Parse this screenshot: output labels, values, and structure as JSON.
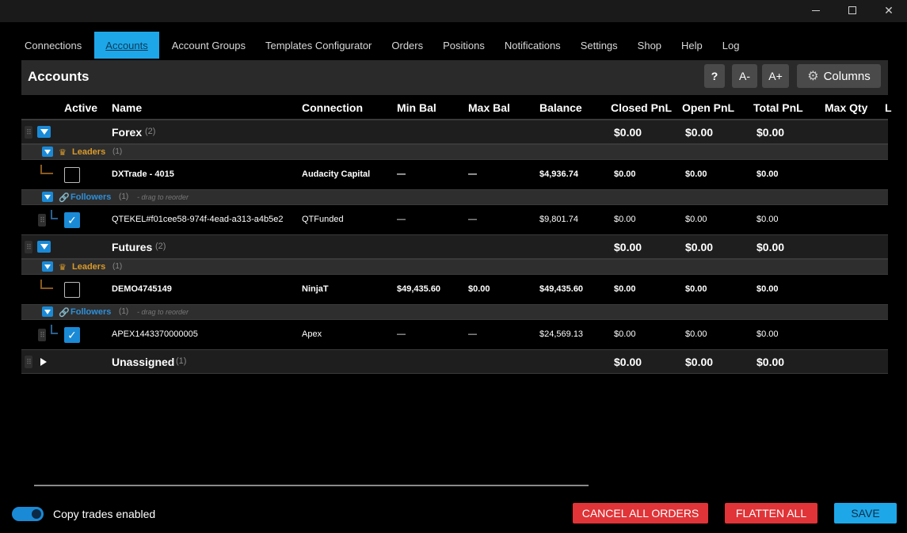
{
  "tabs": [
    "Connections",
    "Accounts",
    "Account Groups",
    "Templates Configurator",
    "Orders",
    "Positions",
    "Notifications",
    "Settings",
    "Shop",
    "Help",
    "Log"
  ],
  "active_tab": "Accounts",
  "panel": {
    "title": "Accounts",
    "help_label": "?",
    "font_down_label": "A-",
    "font_up_label": "A+",
    "columns_label": "Columns"
  },
  "columns": [
    "Active",
    "Name",
    "Connection",
    "Min Bal",
    "Max Bal",
    "Balance",
    "Closed PnL",
    "Open PnL",
    "Total PnL",
    "Max Qty",
    "L"
  ],
  "groups": [
    {
      "name": "Forex",
      "count": "(2)",
      "closed_pnl": "$0.00",
      "open_pnl": "$0.00",
      "total_pnl": "$0.00",
      "leaders": {
        "label": "Leaders",
        "count": "(1)",
        "accounts": [
          {
            "name": "DXTrade - 4015",
            "connection": "Audacity Capital",
            "min_bal": "—",
            "max_bal": "—",
            "balance": "$4,936.74",
            "closed_pnl": "$0.00",
            "open_pnl": "$0.00",
            "total_pnl": "$0.00",
            "active": false
          }
        ]
      },
      "followers": {
        "label": "Followers",
        "count": "(1)",
        "hint": "- drag to reorder",
        "accounts": [
          {
            "name": "QTEKEL#f01cee58-974f-4ead-a313-a4b5e2",
            "connection": "QTFunded",
            "min_bal": "—",
            "max_bal": "—",
            "balance": "$9,801.74",
            "closed_pnl": "$0.00",
            "open_pnl": "$0.00",
            "total_pnl": "$0.00",
            "active": true
          }
        ]
      }
    },
    {
      "name": "Futures",
      "count": "(2)",
      "closed_pnl": "$0.00",
      "open_pnl": "$0.00",
      "total_pnl": "$0.00",
      "leaders": {
        "label": "Leaders",
        "count": "(1)",
        "accounts": [
          {
            "name": "DEMO4745149",
            "connection": "NinjaT",
            "min_bal": "$49,435.60",
            "max_bal": "$0.00",
            "balance": "$49,435.60",
            "closed_pnl": "$0.00",
            "open_pnl": "$0.00",
            "total_pnl": "$0.00",
            "active": false
          }
        ]
      },
      "followers": {
        "label": "Followers",
        "count": "(1)",
        "hint": "- drag to reorder",
        "accounts": [
          {
            "name": "APEX1443370000005",
            "connection": "Apex",
            "min_bal": "—",
            "max_bal": "—",
            "balance": "$24,569.13",
            "closed_pnl": "$0.00",
            "open_pnl": "$0.00",
            "total_pnl": "$0.00",
            "active": true
          }
        ]
      }
    },
    {
      "name": "Unassigned",
      "count": "(1)",
      "closed_pnl": "$0.00",
      "open_pnl": "$0.00",
      "total_pnl": "$0.00"
    }
  ],
  "footer": {
    "copy_trades_label": "Copy trades enabled",
    "copy_trades_on": true,
    "cancel_all_label": "CANCEL ALL ORDERS",
    "flatten_all_label": "FLATTEN ALL",
    "save_label": "SAVE"
  },
  "colors": {
    "accent": "#1ea7e8",
    "danger": "#e03438",
    "leaders": "#d99a2b",
    "followers": "#2e8fd8"
  },
  "icons": {
    "leaders": "crown-icon",
    "followers": "link-icon",
    "columns": "gear-icon"
  }
}
